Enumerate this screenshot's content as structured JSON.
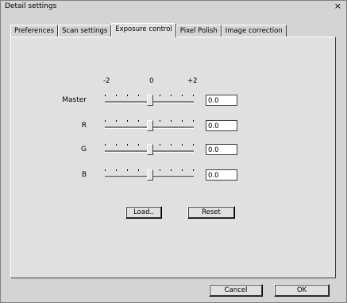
{
  "window": {
    "title": "Detail settings",
    "close_glyph": "×"
  },
  "tabs": [
    {
      "label": "Preferences",
      "active": false
    },
    {
      "label": "Scan settings",
      "active": false
    },
    {
      "label": "Exposure control",
      "active": true
    },
    {
      "label": "Pixel Polish",
      "active": false
    },
    {
      "label": "Image correction",
      "active": false
    }
  ],
  "scale": {
    "min": "-2",
    "mid": "0",
    "max": "+2"
  },
  "sliders": [
    {
      "label": "Master",
      "value": "0.0",
      "level": 0
    },
    {
      "label": "R",
      "value": "0.0",
      "level": 0
    },
    {
      "label": "G",
      "value": "0.0",
      "level": 0
    },
    {
      "label": "B",
      "value": "0.0",
      "level": 0
    }
  ],
  "buttons": {
    "load": "Load..",
    "reset": "Reset",
    "cancel": "Cancel",
    "ok": "OK"
  }
}
